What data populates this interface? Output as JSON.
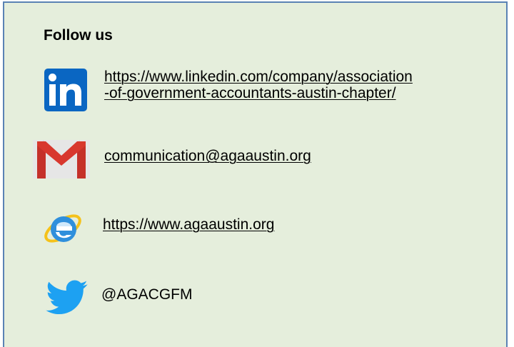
{
  "section": {
    "title": "Follow us"
  },
  "links": {
    "linkedin": {
      "icon": "linkedin-icon",
      "line1": "https://www.linkedin.com/company/association",
      "line2": "-of-government-accountants-austin-chapter/"
    },
    "email": {
      "icon": "gmail-icon",
      "text": "communication@agaaustin.org"
    },
    "website": {
      "icon": "internet-explorer-icon",
      "text": "https://www.agaaustin.org"
    },
    "twitter": {
      "icon": "twitter-icon",
      "text": "@AGACGFM"
    }
  },
  "colors": {
    "panel_background": "#e5eedc",
    "panel_border": "#5a82b4",
    "linkedin_blue": "#0a66c2",
    "twitter_blue": "#1da1f2"
  }
}
